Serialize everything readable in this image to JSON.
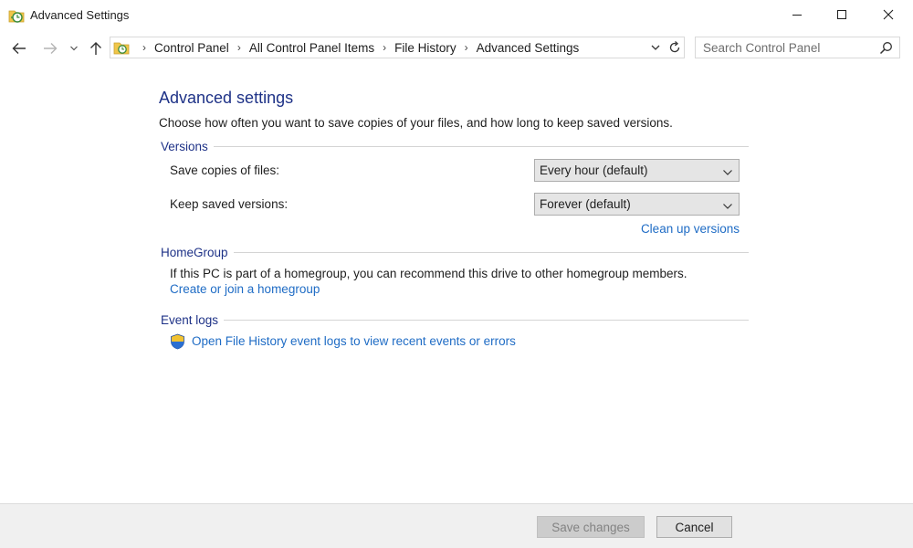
{
  "window": {
    "title": "Advanced Settings",
    "icon": "file-history-icon"
  },
  "nav": {
    "breadcrumbs": [
      "Control Panel",
      "All Control Panel Items",
      "File History",
      "Advanced Settings"
    ],
    "search_placeholder": "Search Control Panel"
  },
  "main": {
    "title": "Advanced settings",
    "description": "Choose how often you want to save copies of your files, and how long to keep saved versions.",
    "versions": {
      "heading": "Versions",
      "save_copies_label": "Save copies of files:",
      "save_copies_value": "Every hour (default)",
      "keep_versions_label": "Keep saved versions:",
      "keep_versions_value": "Forever (default)",
      "cleanup_link": "Clean up versions"
    },
    "homegroup": {
      "heading": "HomeGroup",
      "text": "If this PC is part of a homegroup, you can recommend this drive to other homegroup members.",
      "link": "Create or join a homegroup"
    },
    "event_logs": {
      "heading": "Event logs",
      "link": "Open File History event logs to view recent events or errors"
    }
  },
  "footer": {
    "save_label": "Save changes",
    "cancel_label": "Cancel"
  },
  "colors": {
    "heading_blue": "#1e3287",
    "link_blue": "#1f6cc5"
  }
}
